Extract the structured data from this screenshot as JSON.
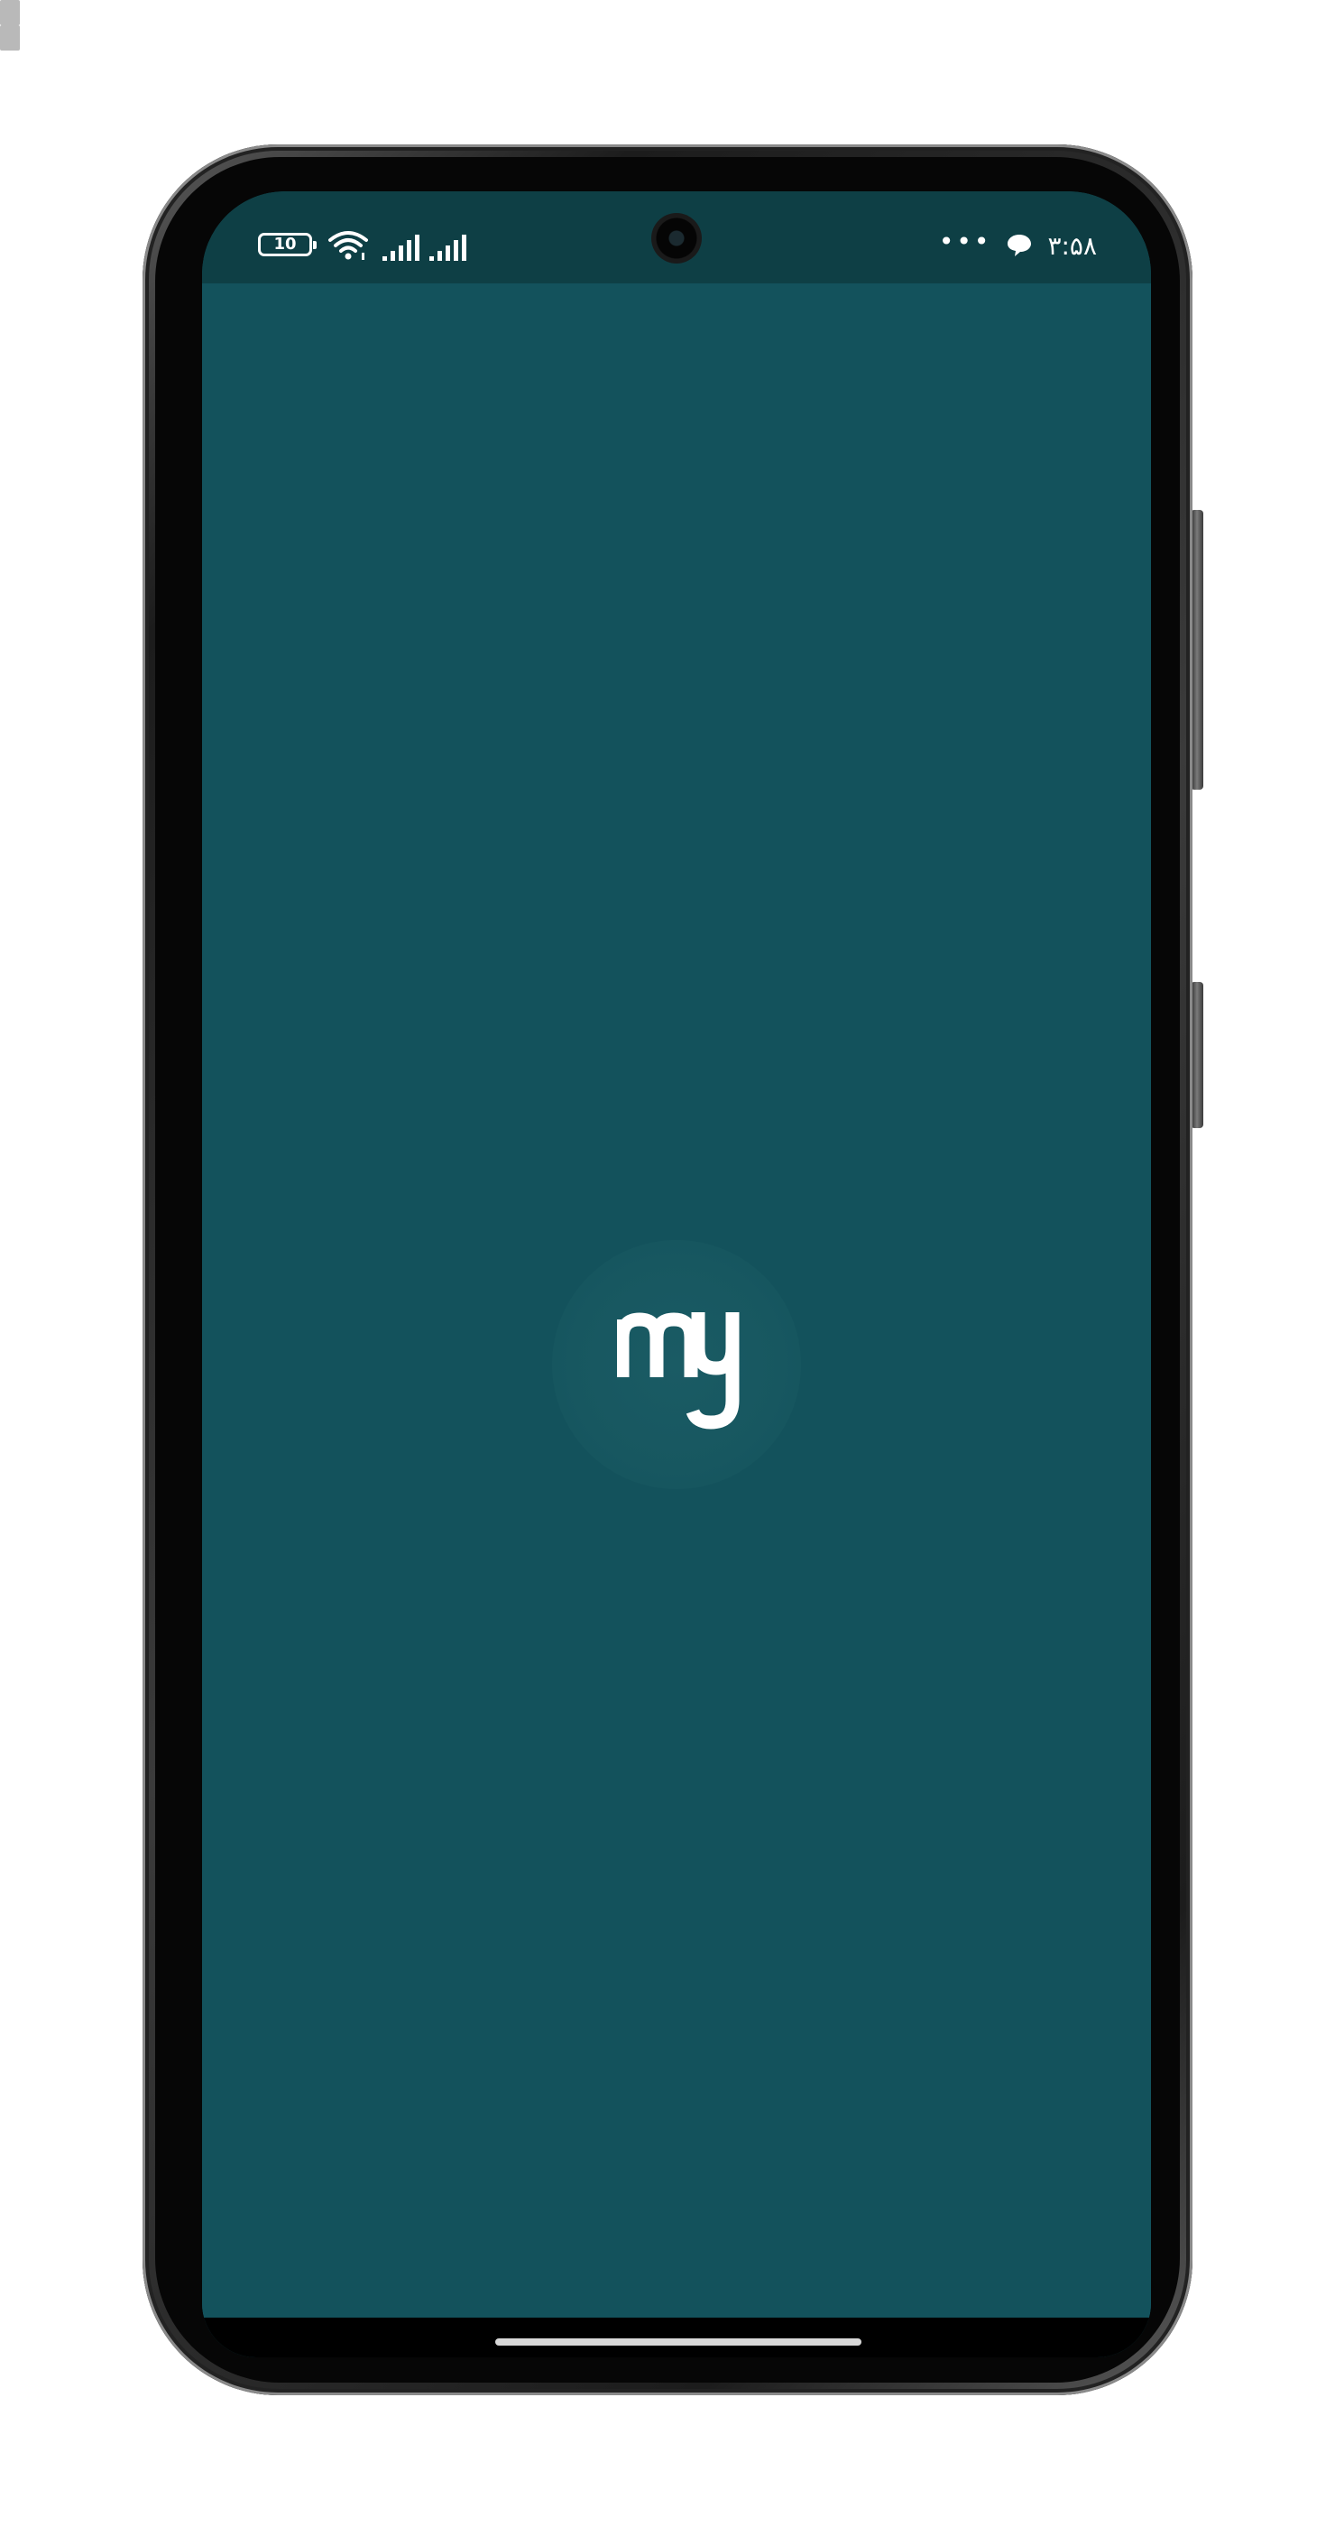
{
  "status_bar": {
    "battery_level": "10",
    "battery_color": "#e0b43b",
    "time": "۳:۵۸",
    "overflow_dots": "•••",
    "icons": [
      "battery-icon",
      "wifi-icon",
      "signal-icon",
      "signal-icon",
      "more-dots-icon",
      "chat-bubble-icon"
    ]
  },
  "splash": {
    "logo_text": "my",
    "background_color": "#13525c",
    "status_bar_color": "#0e3f45"
  }
}
